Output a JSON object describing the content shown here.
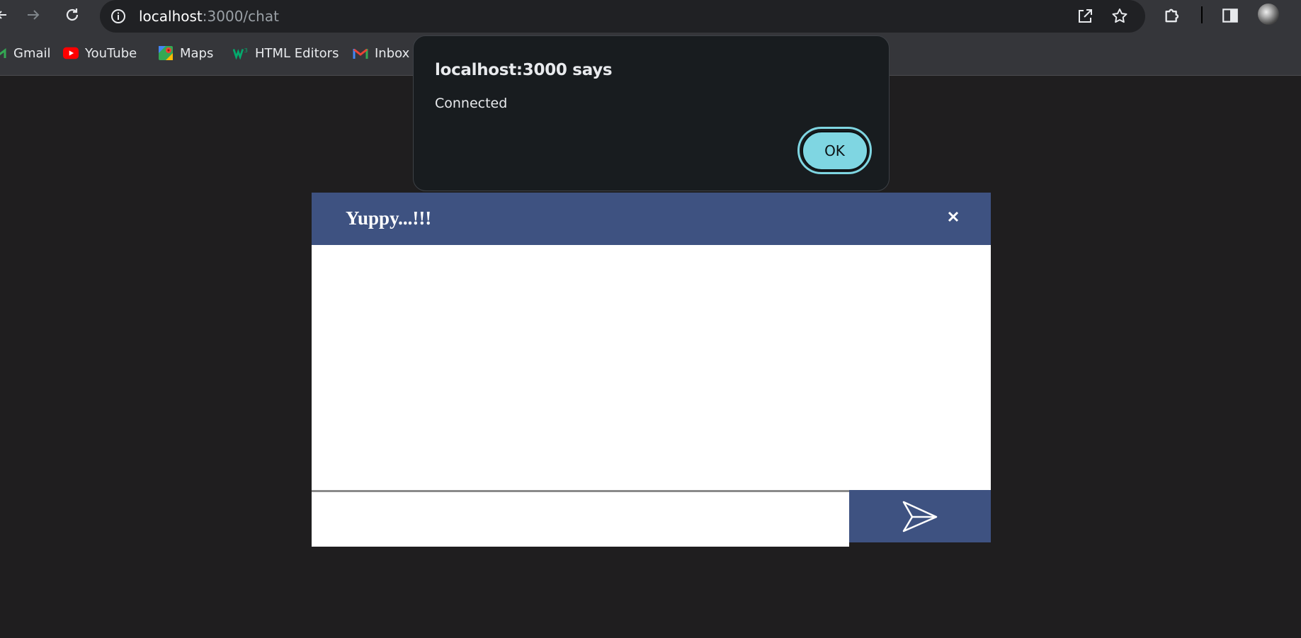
{
  "browser": {
    "url_host": "localhost",
    "url_path": ":3000/chat",
    "bookmarks": [
      {
        "label": "Gmail",
        "icon": "gmail-icon"
      },
      {
        "label": "YouTube",
        "icon": "youtube-icon"
      },
      {
        "label": "Maps",
        "icon": "maps-icon"
      },
      {
        "label": "HTML Editors",
        "icon": "w3-icon"
      },
      {
        "label": "Inbox (",
        "icon": "gmail-icon"
      }
    ]
  },
  "dialog": {
    "title": "localhost:3000 says",
    "message": "Connected",
    "ok_label": "OK"
  },
  "chat": {
    "title": "Yuppy...!!!",
    "close_symbol": "×",
    "input_value": "",
    "accent_color": "#3e5281"
  }
}
